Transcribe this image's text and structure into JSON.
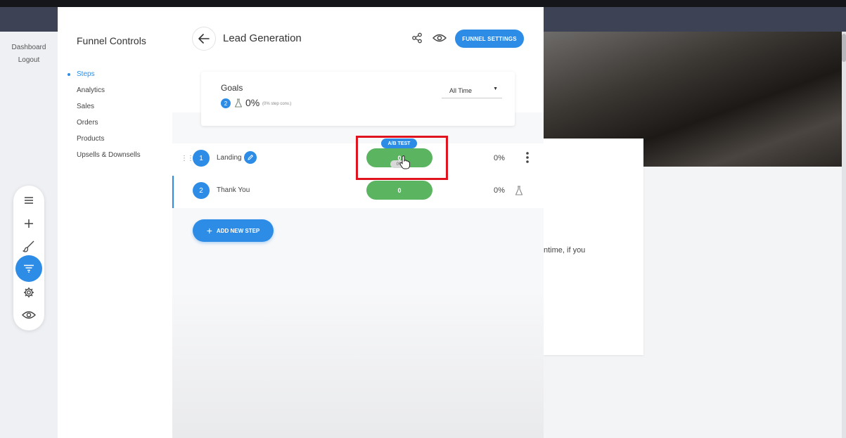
{
  "left_nav": {
    "items": [
      "Dashboard",
      "Logout"
    ]
  },
  "sidebar": {
    "title": "Funnel Controls",
    "items": [
      {
        "label": "Steps",
        "active": true
      },
      {
        "label": "Analytics",
        "active": false
      },
      {
        "label": "Sales",
        "active": false
      },
      {
        "label": "Orders",
        "active": false
      },
      {
        "label": "Products",
        "active": false
      },
      {
        "label": "Upsells & Downsells",
        "active": false
      }
    ]
  },
  "header": {
    "title": "Lead Generation",
    "settings_label": "FUNNEL SETTINGS",
    "icons": [
      "back-arrow-icon",
      "share-icon",
      "eye-icon"
    ]
  },
  "goals": {
    "label": "Goals",
    "count": "2",
    "percent": "0%",
    "conversion_note": "(0% step conv.)",
    "time_filter": "All Time"
  },
  "steps": [
    {
      "number": "1",
      "name": "Landing",
      "ab_label": "A/B TEST",
      "value": "0",
      "sub_value": "0%",
      "percent": "0%"
    },
    {
      "number": "2",
      "name": "Thank You",
      "value": "0",
      "percent": "0%"
    }
  ],
  "add_step_label": "ADD NEW STEP",
  "palette_icons": [
    "menu-icon",
    "plus-icon",
    "brush-icon",
    "funnel-icon",
    "gear-icon",
    "eye-icon"
  ],
  "background": {
    "exclamation": "!",
    "text": "ntime, if you"
  },
  "colors": {
    "accent": "#2d8ce6",
    "success": "#5bb560",
    "highlight": "#e0141e"
  }
}
